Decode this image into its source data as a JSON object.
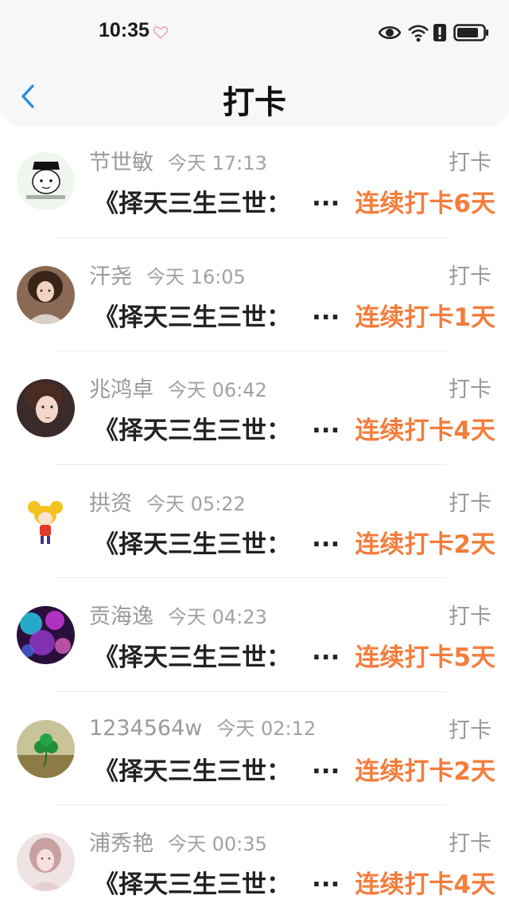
{
  "status_bar": {
    "time": "10:35",
    "icons": [
      "heart-icon",
      "eye-icon",
      "wifi-icon",
      "sim-alert-icon",
      "battery-icon"
    ]
  },
  "header": {
    "back_icon": "chevron-left-icon",
    "title": "打卡"
  },
  "colors": {
    "accent": "#f47d3c",
    "back": "#2b8fe0",
    "muted": "#9a9a9a"
  },
  "items": [
    {
      "name": "节世敏",
      "time": "今天 17:13",
      "kind": "打卡",
      "book": "《择天三生三世：",
      "ellipsis": "...",
      "streak": "连续打卡6天",
      "avatar": "cartoon-face-avatar"
    },
    {
      "name": "汗尧",
      "time": "今天 16:05",
      "kind": "打卡",
      "book": "《择天三生三世：",
      "ellipsis": "...",
      "streak": "连续打卡1天",
      "avatar": "girl-portrait-avatar"
    },
    {
      "name": "兆鸿卓",
      "time": "今天 06:42",
      "kind": "打卡",
      "book": "《择天三生三世：",
      "ellipsis": "...",
      "streak": "连续打卡4天",
      "avatar": "boy-portrait-avatar"
    },
    {
      "name": "拱资",
      "time": "今天 05:22",
      "kind": "打卡",
      "book": "《择天三生三世：",
      "ellipsis": "...",
      "streak": "连续打卡2天",
      "avatar": "anime-character-avatar"
    },
    {
      "name": "贡海逸",
      "time": "今天 04:23",
      "kind": "打卡",
      "book": "《择天三生三世：",
      "ellipsis": "...",
      "streak": "连续打卡5天",
      "avatar": "bokeh-lights-avatar"
    },
    {
      "name": "1234564w",
      "time": "今天 02:12",
      "kind": "打卡",
      "book": "《择天三生三世：",
      "ellipsis": "...",
      "streak": "连续打卡2天",
      "avatar": "clover-avatar"
    },
    {
      "name": "浦秀艳",
      "time": "今天 00:35",
      "kind": "打卡",
      "book": "《择天三生三世：",
      "ellipsis": "...",
      "streak": "连续打卡4天",
      "avatar": "woman-portrait-avatar"
    }
  ]
}
